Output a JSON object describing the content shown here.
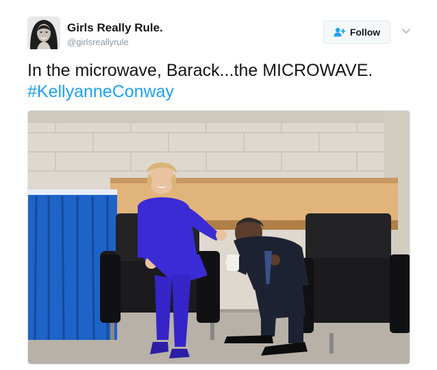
{
  "user": {
    "display_name": "Girls Really Rule.",
    "handle": "@girlsreallyrule"
  },
  "follow_button": {
    "label": "Follow"
  },
  "tweet": {
    "text": "In the microwave, Barack...the MICROWAVE.",
    "hashtag": "#KellyanneConway"
  },
  "media": {
    "alt": "Photo: woman in a blue pantsuit and a man in a dark suit laughing in black armchairs in a backstage room"
  },
  "colors": {
    "hashtag": "#1da1f2",
    "handle": "#8899a6",
    "follow_icon": "#1da1f2"
  },
  "icons": {
    "follow": "add-user-icon",
    "caret": "chevron-down-icon"
  }
}
